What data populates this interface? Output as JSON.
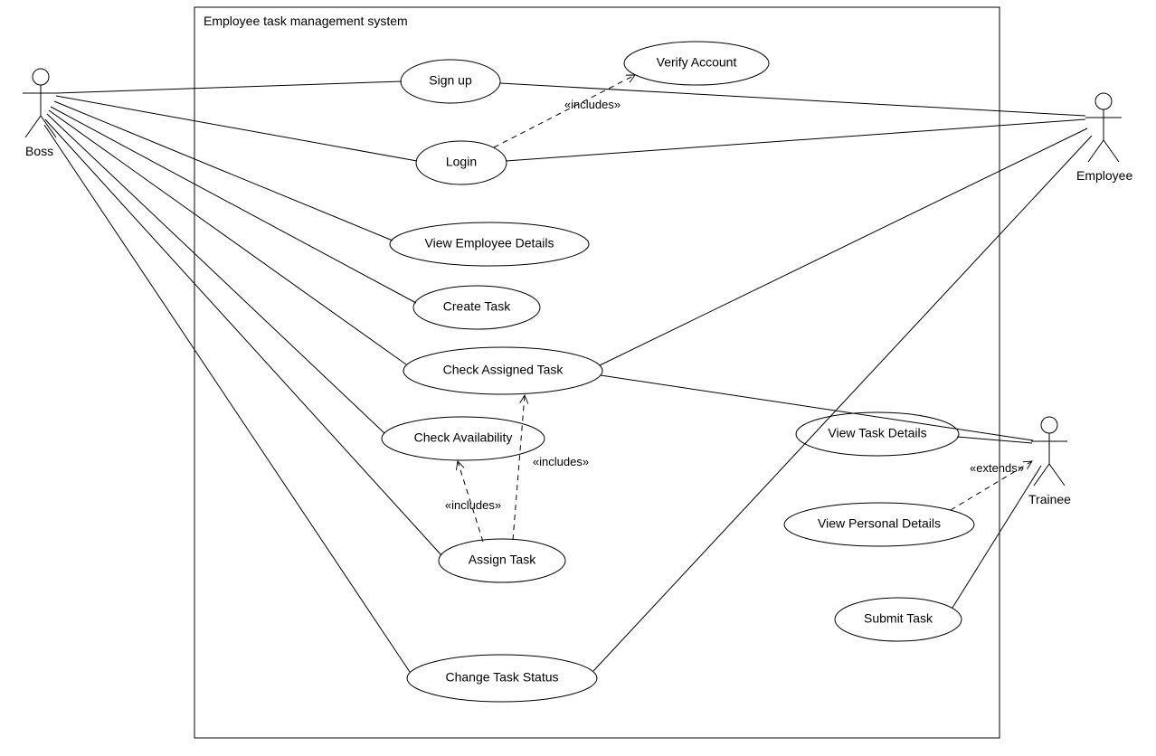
{
  "system_title": "Employee task management system",
  "actors": {
    "boss": "Boss",
    "employee": "Employee",
    "trainee": "Trainee"
  },
  "use_cases": {
    "signup": "Sign up",
    "login": "Login",
    "verify": "Verify Account",
    "view_emp": "View Employee Details",
    "create_task": "Create Task",
    "check_assigned": "Check Assigned Task",
    "check_avail": "Check Availability",
    "assign_task": "Assign Task",
    "change_status": "Change Task Status",
    "view_task": "View Task Details",
    "view_personal": "View Personal Details",
    "submit_task": "Submit Task"
  },
  "stereotypes": {
    "includes": "«includes»",
    "extends": "«extends»"
  },
  "chart_data": {
    "type": "diagram",
    "diagram_type": "UML Use Case Diagram",
    "system": "Employee task management system",
    "actors": [
      "Boss",
      "Employee",
      "Trainee"
    ],
    "use_cases": [
      "Sign up",
      "Login",
      "Verify Account",
      "View Employee Details",
      "Create Task",
      "Check Assigned Task",
      "Check Availability",
      "Assign Task",
      "Change Task Status",
      "View Task Details",
      "View Personal Details",
      "Submit Task"
    ],
    "associations": [
      {
        "actor": "Boss",
        "use_case": "Sign up"
      },
      {
        "actor": "Boss",
        "use_case": "Login"
      },
      {
        "actor": "Boss",
        "use_case": "View Employee Details"
      },
      {
        "actor": "Boss",
        "use_case": "Create Task"
      },
      {
        "actor": "Boss",
        "use_case": "Check Assigned Task"
      },
      {
        "actor": "Boss",
        "use_case": "Check Availability"
      },
      {
        "actor": "Boss",
        "use_case": "Assign Task"
      },
      {
        "actor": "Boss",
        "use_case": "Change Task Status"
      },
      {
        "actor": "Employee",
        "use_case": "Sign up"
      },
      {
        "actor": "Employee",
        "use_case": "Login"
      },
      {
        "actor": "Employee",
        "use_case": "Check Assigned Task"
      },
      {
        "actor": "Employee",
        "use_case": "Change Task Status"
      },
      {
        "actor": "Trainee",
        "use_case": "Check Assigned Task"
      },
      {
        "actor": "Trainee",
        "use_case": "View Task Details"
      },
      {
        "actor": "Trainee",
        "use_case": "View Personal Details"
      },
      {
        "actor": "Trainee",
        "use_case": "Submit Task"
      }
    ],
    "includes": [
      {
        "from": "Login",
        "to": "Verify Account"
      },
      {
        "from": "Assign Task",
        "to": "Check Availability"
      },
      {
        "from": "Assign Task",
        "to": "Check Assigned Task"
      }
    ],
    "extends": [
      {
        "from": "View Personal Details",
        "to": "Trainee"
      }
    ]
  }
}
